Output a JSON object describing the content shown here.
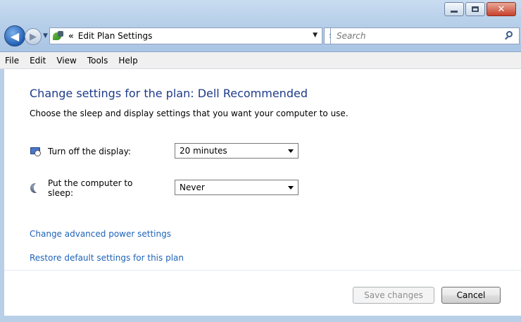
{
  "window": {
    "minimize_icon": "minimize-icon",
    "maximize_icon": "maximize-icon",
    "close_icon": "close-icon",
    "close_glyph": "✕"
  },
  "navigation": {
    "back_glyph": "◀",
    "forward_glyph": "▶",
    "address": {
      "chevron": "«",
      "path": "Edit Plan Settings"
    },
    "search": {
      "placeholder": "Search"
    }
  },
  "menubar": {
    "items": [
      "File",
      "Edit",
      "View",
      "Tools",
      "Help"
    ]
  },
  "page": {
    "title": "Change settings for the plan: Dell Recommended",
    "description": "Choose the sleep and display settings that you want your computer to use.",
    "settings": [
      {
        "label": "Turn off the display:",
        "value": "20 minutes",
        "icon": "monitor-clock-icon"
      },
      {
        "label": "Put the computer to sleep:",
        "value": "Never",
        "icon": "moon-icon"
      }
    ],
    "links": {
      "advanced": "Change advanced power settings",
      "restore": "Restore default settings for this plan"
    },
    "buttons": {
      "save": "Save changes",
      "cancel": "Cancel"
    }
  },
  "colors": {
    "title_blue": "#1e3b8a",
    "link_blue": "#1e63b8",
    "chrome_blue": "#b7cfe9"
  }
}
